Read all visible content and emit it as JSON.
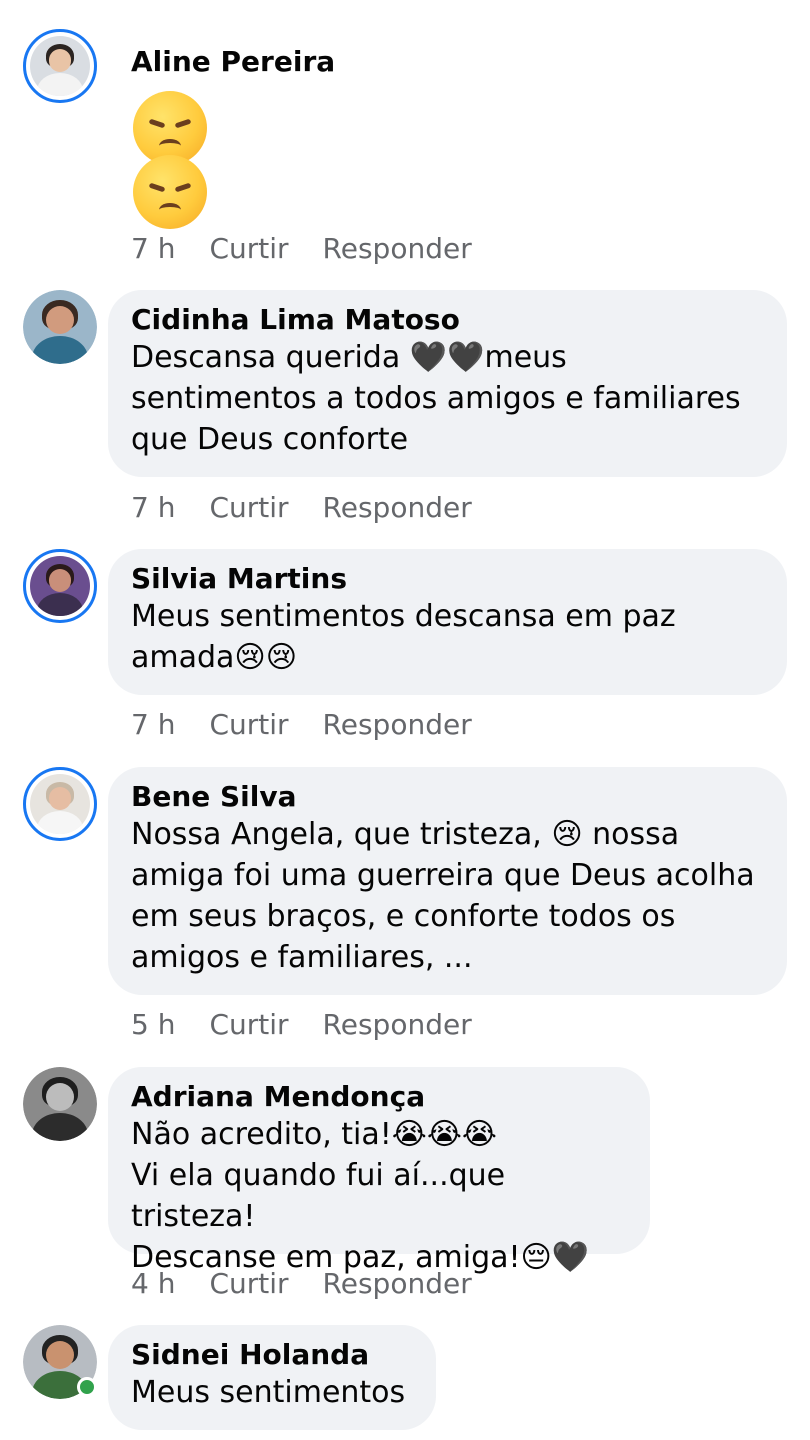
{
  "comments": [
    {
      "author": "Aline Pereira",
      "text": "",
      "emojis": [
        "pensive-face",
        "pensive-face"
      ],
      "time": "7 h",
      "like": "Curtir",
      "reply": "Responder",
      "story_ring": true
    },
    {
      "author": "Cidinha Lima Matoso",
      "text": "Descansa querida   🖤🖤meus\nsentimentos a todos amigos e familiares\nque Deus conforte",
      "time": "7 h",
      "like": "Curtir",
      "reply": "Responder",
      "story_ring": false
    },
    {
      "author": "Silvia Martins",
      "text": "Meus sentimentos descansa em paz\namada😢😢",
      "time": "7 h",
      "like": "Curtir",
      "reply": "Responder",
      "story_ring": true
    },
    {
      "author": "Bene Silva",
      "text": "Nossa Angela, que tristeza, 😢 nossa\namiga foi uma guerreira que Deus acolha\nem seus braços, e conforte todos os\namigos e familiares, ...",
      "time": "5 h",
      "like": "Curtir",
      "reply": "Responder",
      "story_ring": true
    },
    {
      "author": "Adriana Mendonça",
      "text": "Não acredito, tia!😭😭😭\nVi ela quando fui aí...que tristeza!\nDescanse em paz, amiga!😔🖤",
      "time": "4 h",
      "like": "Curtir",
      "reply": "Responder",
      "story_ring": false
    },
    {
      "author": "Sidnei Holanda",
      "text": "Meus sentimentos",
      "story_ring": false,
      "online": true
    }
  ],
  "colors": {
    "bubble": "#f0f2f5",
    "story_ring": "#1877f2",
    "meta_text": "#65676b",
    "online": "#31a24c"
  }
}
